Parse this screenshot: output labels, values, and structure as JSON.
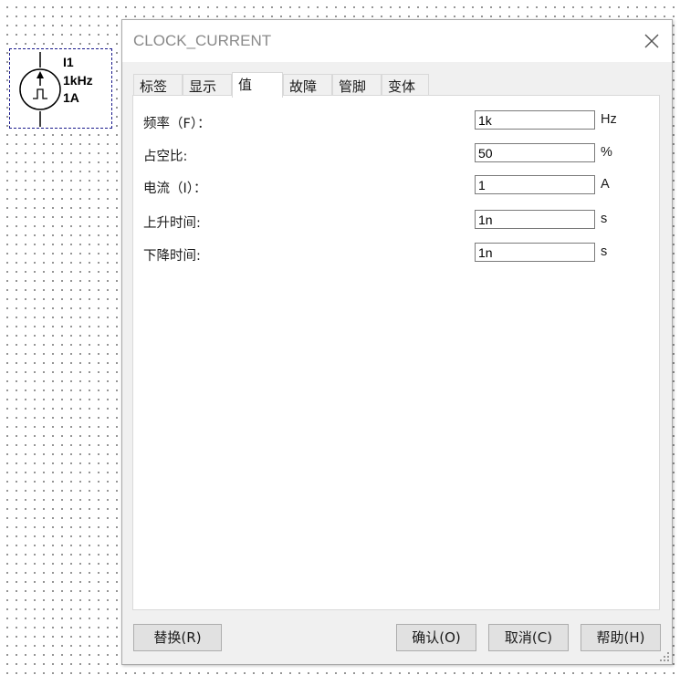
{
  "component": {
    "ref": "I1",
    "frequency": "1kHz",
    "current": "1A"
  },
  "dialog": {
    "title": "CLOCK_CURRENT",
    "tabs": [
      {
        "label": "标签",
        "active": false
      },
      {
        "label": "显示",
        "active": false
      },
      {
        "label": "值",
        "active": true
      },
      {
        "label": "故障",
        "active": false
      },
      {
        "label": "管脚",
        "active": false
      },
      {
        "label": "变体",
        "active": false
      }
    ],
    "fields": [
      {
        "label": "频率（F）：",
        "value": "1k",
        "unit": "Hz"
      },
      {
        "label": "占空比:",
        "value": "50",
        "unit": "%"
      },
      {
        "label": "电流（I）：",
        "value": "1",
        "unit": "A"
      },
      {
        "label": "上升时间:",
        "value": "1n",
        "unit": "s"
      },
      {
        "label": "下降时间:",
        "value": "1n",
        "unit": "s"
      }
    ],
    "buttons": {
      "replace": "替换(R)",
      "ok": "确认(O)",
      "cancel": "取消(C)",
      "help": "帮助(H)"
    }
  },
  "colors": {
    "selection_border": "#1a1a8c",
    "canvas_dots": "#7a7a7a",
    "dialog_bg": "#f0f0f0",
    "title_text": "#8a8a8a"
  },
  "icons": {
    "source_symbol": "clock-current-source-icon",
    "close": "close-icon",
    "resize": "resize-grip-icon"
  }
}
